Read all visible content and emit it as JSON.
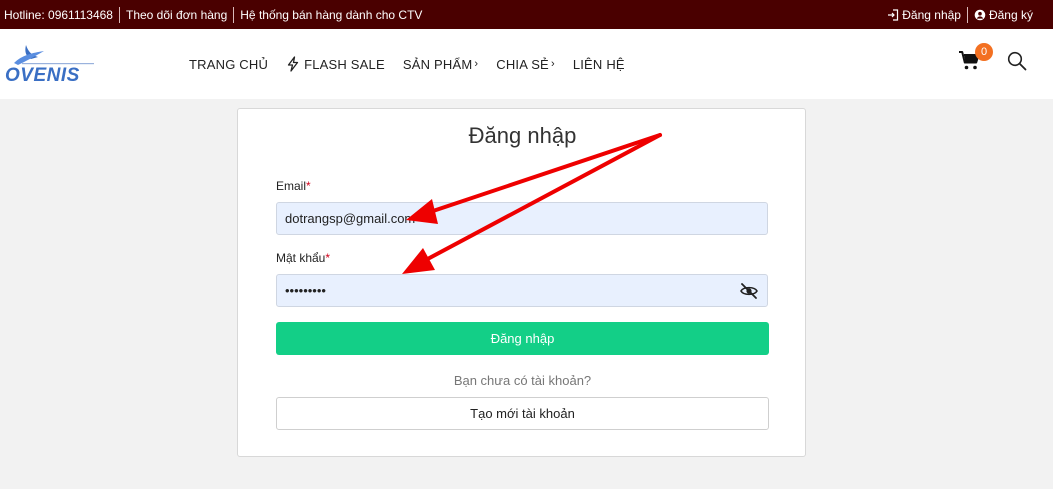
{
  "topbar": {
    "hotline": "Hotline: 0961113468",
    "track_order": "Theo dõi đơn hàng",
    "ctv_system": "Hệ thống bán hàng dành cho CTV",
    "login": "Đăng nhập",
    "register": "Đăng ký"
  },
  "header": {
    "logo_text": "OVENIS",
    "nav": [
      {
        "label": "TRANG CHỦ"
      },
      {
        "label": "FLASH SALE",
        "icon": "lightning-icon"
      },
      {
        "label": "SẢN PHẨM",
        "chevron": "›"
      },
      {
        "label": "CHIA SẺ",
        "chevron": "›"
      },
      {
        "label": "LIÊN HỆ"
      }
    ],
    "cart_count": "0"
  },
  "form": {
    "title": "Đăng nhập",
    "email_label": "Email",
    "email_value": "dotrangsp@gmail.com",
    "password_label": "Mật khẩu",
    "password_value": "•••••••••",
    "required_mark": "*",
    "submit_label": "Đăng nhập",
    "no_account": "Bạn chưa có tài khoản?",
    "create_label": "Tạo mới tài khoản"
  },
  "colors": {
    "topbar_bg": "#4a0000",
    "submit_bg": "#13cf87",
    "badge": "#f37021",
    "arrow": "#ee0000"
  }
}
